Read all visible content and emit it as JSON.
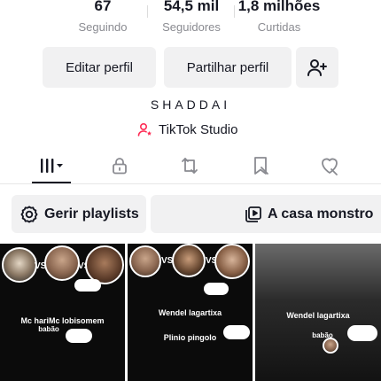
{
  "stats": [
    {
      "value": "67",
      "label": "Seguindo"
    },
    {
      "value": "54,5 mil",
      "label": "Seguidores"
    },
    {
      "value": "1,8 milhões",
      "label": "Curtidas"
    }
  ],
  "actions": {
    "edit_label": "Editar perfil",
    "share_label": "Partilhar perfil",
    "add_friend_icon": "add-user-icon"
  },
  "profile": {
    "bio": "SHADDAI",
    "studio_label": "TikTok Studio"
  },
  "tabs": [
    {
      "icon": "grid-icon",
      "active": true
    },
    {
      "icon": "lock-icon",
      "active": false
    },
    {
      "icon": "repost-icon",
      "active": false
    },
    {
      "icon": "bookmark-icon",
      "active": false
    },
    {
      "icon": "liked-heart-icon",
      "active": false
    }
  ],
  "playlists": {
    "manage_label": "Gerir playlists",
    "playlist_name": "A casa monstro"
  },
  "videos": [
    {
      "caption_1": "Mc hariMc lobisomem",
      "caption_2": "babão"
    },
    {
      "caption_1": "Wendel lagartixa",
      "caption_2": "Plinio pingolo"
    },
    {
      "caption_1": "Wendel lagartixa",
      "caption_2": "babão"
    }
  ],
  "colors": {
    "text": "#161823",
    "muted": "#8a8b91",
    "button_bg": "#f1f1f2",
    "accent_pink": "#fe2c55"
  }
}
